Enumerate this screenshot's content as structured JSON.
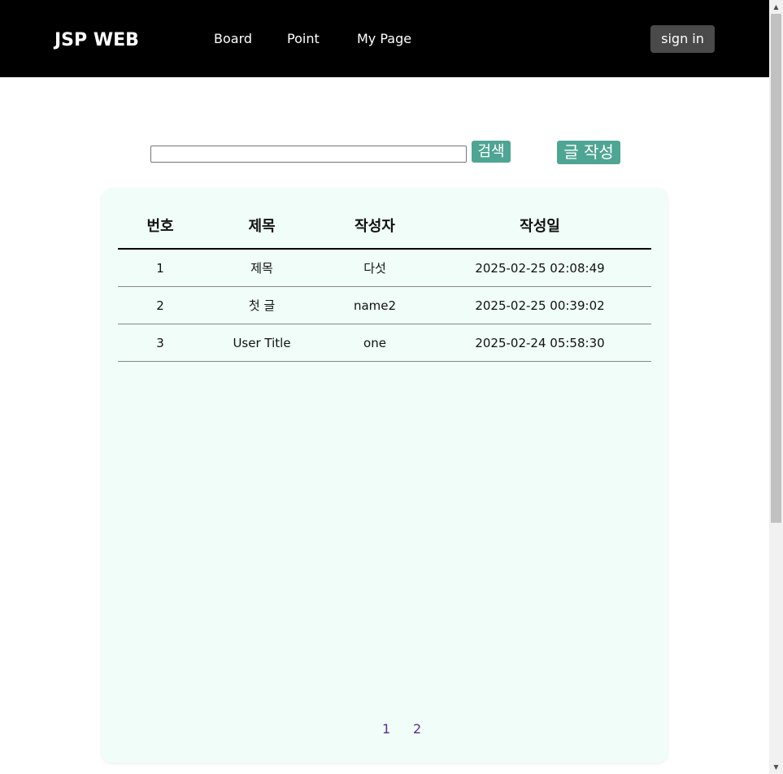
{
  "header": {
    "logo": "JSP WEB",
    "nav": [
      "Board",
      "Point",
      "My Page"
    ],
    "sign_in_label": "sign in",
    "background_color": "#000000"
  },
  "search": {
    "input_value": "",
    "placeholder": "",
    "search_button_label": "검색",
    "write_button_label": "글 작성",
    "button_color": "#4fa593"
  },
  "table": {
    "columns": [
      "번호",
      "제목",
      "작성자",
      "작성일"
    ],
    "rows": [
      {
        "no": "1",
        "title": "제목",
        "author": "다섯",
        "date": "2025-02-25 02:08:49"
      },
      {
        "no": "2",
        "title": "첫 글",
        "author": "name2",
        "date": "2025-02-25 00:39:02"
      },
      {
        "no": "3",
        "title": "User Title",
        "author": "one",
        "date": "2025-02-24 05:58:30"
      }
    ]
  },
  "pagination": {
    "pages": [
      "1",
      "2"
    ]
  },
  "card_color": "#f0fdf8"
}
